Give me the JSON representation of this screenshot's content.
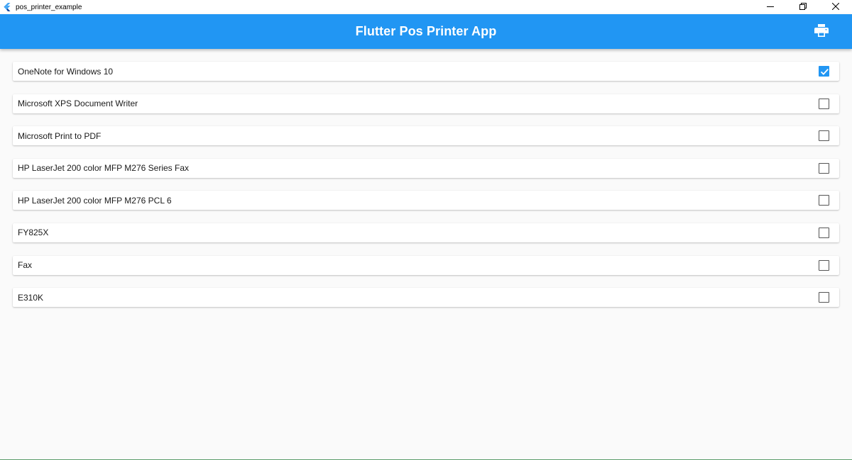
{
  "window": {
    "title": "pos_printer_example",
    "app_icon": "flutter-logo-icon",
    "controls": [
      "minimize-icon",
      "restore-icon",
      "close-icon"
    ]
  },
  "appbar": {
    "title": "Flutter Pos Printer App",
    "action_icon": "print-icon",
    "color": "#2196f3"
  },
  "printers": [
    {
      "name": "OneNote for Windows 10",
      "selected": true
    },
    {
      "name": "Microsoft XPS Document Writer",
      "selected": false
    },
    {
      "name": "Microsoft Print to PDF",
      "selected": false
    },
    {
      "name": "HP LaserJet 200 color MFP M276 Series Fax",
      "selected": false
    },
    {
      "name": "HP LaserJet 200 color MFP M276 PCL 6",
      "selected": false
    },
    {
      "name": "FY825X",
      "selected": false
    },
    {
      "name": "Fax",
      "selected": false
    },
    {
      "name": "E310K",
      "selected": false
    }
  ],
  "colors": {
    "accent": "#2196f3",
    "checkbox_border": "#545454",
    "background": "#fafafa"
  }
}
